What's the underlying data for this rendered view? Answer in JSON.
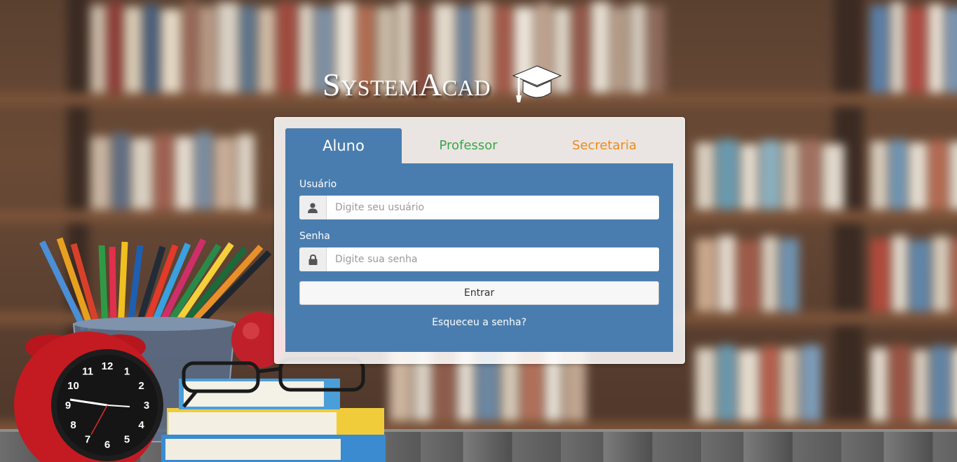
{
  "logo": {
    "text": "SystemAcad",
    "icon": "graduation-cap-icon"
  },
  "tabs": [
    {
      "label": "Aluno",
      "active": true,
      "color": "#ffffff"
    },
    {
      "label": "Professor",
      "active": false,
      "color": "#3aa64a"
    },
    {
      "label": "Secretaria",
      "active": false,
      "color": "#f08a18"
    }
  ],
  "form": {
    "username": {
      "label": "Usuário",
      "placeholder": "Digite seu usuário",
      "value": "",
      "icon": "user-icon"
    },
    "password": {
      "label": "Senha",
      "placeholder": "Digite sua senha",
      "value": "",
      "icon": "lock-icon"
    },
    "submit_label": "Entrar",
    "forgot_label": "Esqueceu a senha?"
  },
  "colors": {
    "panel_blue": "#4a7daf",
    "professor_green": "#3aa64a",
    "secretaria_orange": "#f08a18"
  },
  "clock": {
    "numbers": [
      "12",
      "1",
      "2",
      "3",
      "4",
      "5",
      "6",
      "7",
      "8",
      "9",
      "10",
      "11"
    ]
  }
}
